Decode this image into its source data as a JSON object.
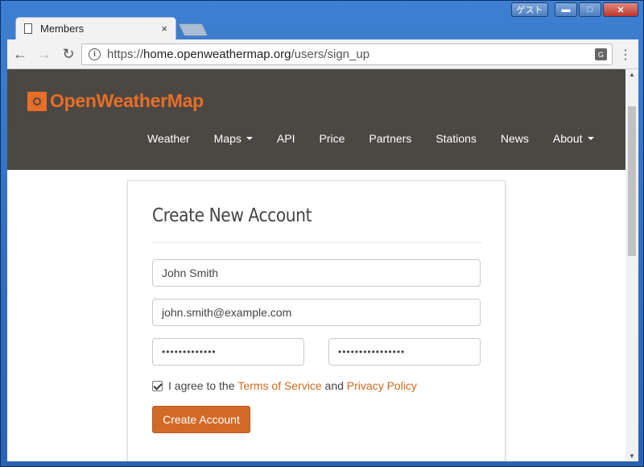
{
  "window": {
    "guest_label": "ゲスト",
    "min": "▬",
    "max": "□",
    "close": "✕"
  },
  "tab": {
    "title": "Members",
    "close": "×"
  },
  "toolbar": {
    "back": "←",
    "forward": "→",
    "reload": "↻",
    "url_scheme": "https://",
    "url_host": "home.openweathermap.org",
    "url_path": "/users/sign_up",
    "translate": "G",
    "menu": "⋮"
  },
  "site": {
    "logo_text": "OpenWeatherMap",
    "brand_color": "#e96e27",
    "nav": [
      {
        "label": "Weather",
        "dropdown": false
      },
      {
        "label": "Maps",
        "dropdown": true
      },
      {
        "label": "API",
        "dropdown": false
      },
      {
        "label": "Price",
        "dropdown": false
      },
      {
        "label": "Partners",
        "dropdown": false
      },
      {
        "label": "Stations",
        "dropdown": false
      },
      {
        "label": "News",
        "dropdown": false
      },
      {
        "label": "About",
        "dropdown": true
      }
    ]
  },
  "form": {
    "title": "Create New Account",
    "username_value": "John Smith",
    "email_value": "john.smith@example.com",
    "password_value": "•••••••••••••",
    "password_confirm_value": "••••••••••••••••",
    "agree_prefix": "I agree to the",
    "terms_link": "Terms of Service",
    "and_text": "and",
    "privacy_link": "Privacy Policy",
    "agree_checked": true,
    "submit_label": "Create Account"
  }
}
